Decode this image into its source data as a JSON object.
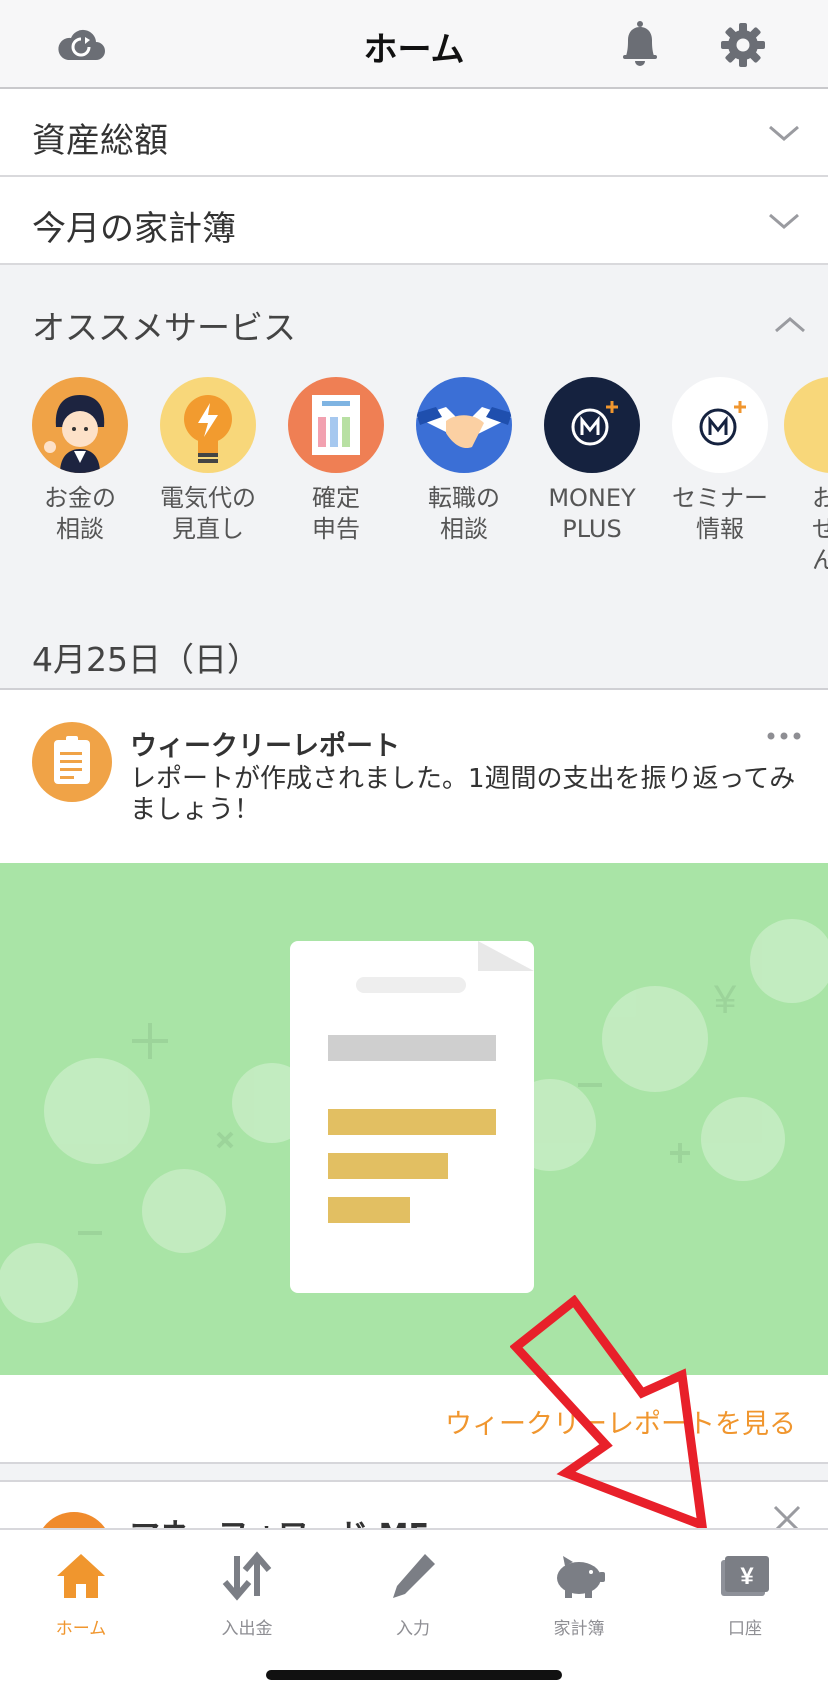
{
  "header": {
    "title": "ホーム"
  },
  "accordions": [
    {
      "label": "資産総額"
    },
    {
      "label": "今月の家計簿"
    }
  ],
  "recommended": {
    "label": "オススメサービス",
    "services": [
      {
        "name": "お金の\n相談",
        "color": "#f0a347"
      },
      {
        "name": "電気代の\n見直し",
        "color": "#f8d77a"
      },
      {
        "name": "確定\n申告",
        "color": "#ef7f54"
      },
      {
        "name": "転職の\n相談",
        "color": "#3b6fd6"
      },
      {
        "name": "MONEY\nPLUS",
        "color": "#15223f"
      },
      {
        "name": "セミナー\n情報",
        "color": "#ffffff"
      },
      {
        "name": "お\nせん",
        "color": "#f8d77a"
      }
    ]
  },
  "date": "4月25日（日）",
  "weekly": {
    "title": "ウィークリーレポート",
    "body": "レポートが作成されました。1週間の支出を振り返ってみましょう！",
    "link": "ウィークリーレポートを見る",
    "banner_color": "#a9e4a6"
  },
  "next_card": {
    "title": "マネーフォワード ME"
  },
  "tabs": [
    {
      "label": "ホーム",
      "icon": "home-icon",
      "active": true
    },
    {
      "label": "入出金",
      "icon": "transfer-icon",
      "active": false
    },
    {
      "label": "入力",
      "icon": "pencil-icon",
      "active": false
    },
    {
      "label": "家計簿",
      "icon": "piggy-bank-icon",
      "active": false
    },
    {
      "label": "口座",
      "icon": "wallet-yen-icon",
      "active": false
    }
  ],
  "colors": {
    "accent": "#f0962e",
    "arrow": "#e8202a"
  }
}
